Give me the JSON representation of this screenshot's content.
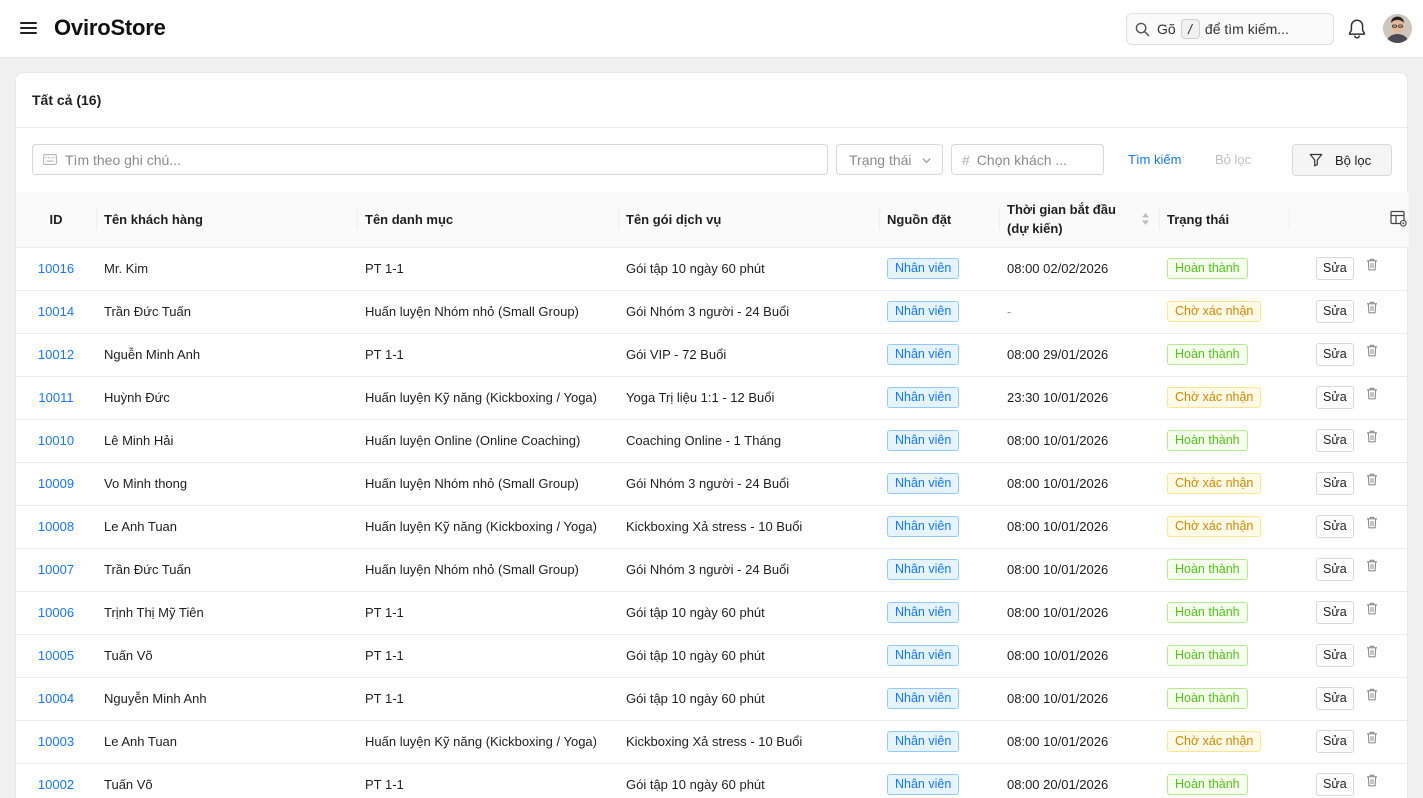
{
  "app": {
    "brand": "OviroStore"
  },
  "header": {
    "search_prefix": "Gõ",
    "search_key": "/",
    "search_suffix": "để tìm kiếm..."
  },
  "card": {
    "title": "Tất cả (16)"
  },
  "filters": {
    "note_placeholder": "Tìm theo ghi chú...",
    "status_placeholder": "Trạng thái",
    "customer_placeholder": "Chọn khách ...",
    "search_label": "Tìm kiếm",
    "clear_label": "Bỏ lọc",
    "filter_label": "Bộ lọc"
  },
  "table": {
    "columns": {
      "id": "ID",
      "customer": "Tên khách hàng",
      "category": "Tên danh mục",
      "package": "Tên gói dịch vụ",
      "source": "Nguồn đặt",
      "start_time": "Thời gian bắt đầu (dự kiến)",
      "status": "Trạng thái"
    },
    "edit_label": "Sửa",
    "status_colors": {
      "Hoàn thành": "#52c41a",
      "Chờ xác nhận": "#d48806"
    },
    "source_color": "#1677ff",
    "rows": [
      {
        "id": "10016",
        "customer": "Mr. Kim",
        "category": "PT 1-1",
        "package": "Gói tập 10 ngày 60 phút",
        "source": "Nhân viên",
        "start_time": "08:00 02/02/2026",
        "status": "Hoàn thành"
      },
      {
        "id": "10014",
        "customer": "Trần Đức Tuấn",
        "category": "Huấn luyện Nhóm nhỏ (Small Group)",
        "package": "Gói Nhóm 3 người - 24 Buổi",
        "source": "Nhân viên",
        "start_time": "-",
        "status": "Chờ xác nhận"
      },
      {
        "id": "10012",
        "customer": "Nguễn Minh Anh",
        "category": "PT 1-1",
        "package": "Gói VIP - 72 Buổi",
        "source": "Nhân viên",
        "start_time": "08:00 29/01/2026",
        "status": "Hoàn thành"
      },
      {
        "id": "10011",
        "customer": "Huỳnh Đức",
        "category": "Huấn luyện Kỹ năng (Kickboxing / Yoga)",
        "package": "Yoga Trị liệu 1:1 - 12 Buổi",
        "source": "Nhân viên",
        "start_time": "23:30 10/01/2026",
        "status": "Chờ xác nhận"
      },
      {
        "id": "10010",
        "customer": "Lê Minh Hải",
        "category": "Huấn luyện Online (Online Coaching)",
        "package": "Coaching Online - 1 Tháng",
        "source": "Nhân viên",
        "start_time": "08:00 10/01/2026",
        "status": "Hoàn thành"
      },
      {
        "id": "10009",
        "customer": "Vo Minh thong",
        "category": "Huấn luyện Nhóm nhỏ (Small Group)",
        "package": "Gói Nhóm 3 người - 24 Buổi",
        "source": "Nhân viên",
        "start_time": "08:00 10/01/2026",
        "status": "Chờ xác nhận"
      },
      {
        "id": "10008",
        "customer": "Le Anh Tuan",
        "category": "Huấn luyện Kỹ năng (Kickboxing / Yoga)",
        "package": "Kickboxing Xả stress - 10 Buổi",
        "source": "Nhân viên",
        "start_time": "08:00 10/01/2026",
        "status": "Chờ xác nhận"
      },
      {
        "id": "10007",
        "customer": "Trần Đức Tuấn",
        "category": "Huấn luyện Nhóm nhỏ (Small Group)",
        "package": "Gói Nhóm 3 người - 24 Buổi",
        "source": "Nhân viên",
        "start_time": "08:00 10/01/2026",
        "status": "Hoàn thành"
      },
      {
        "id": "10006",
        "customer": "Trịnh Thị Mỹ Tiên",
        "category": "PT 1-1",
        "package": "Gói tập 10 ngày 60 phút",
        "source": "Nhân viên",
        "start_time": "08:00 10/01/2026",
        "status": "Hoàn thành"
      },
      {
        "id": "10005",
        "customer": "Tuấn Võ",
        "category": "PT 1-1",
        "package": "Gói tập 10 ngày 60 phút",
        "source": "Nhân viên",
        "start_time": "08:00 10/01/2026",
        "status": "Hoàn thành"
      },
      {
        "id": "10004",
        "customer": "Nguyễn Minh Anh",
        "category": "PT 1-1",
        "package": "Gói tập 10 ngày 60 phút",
        "source": "Nhân viên",
        "start_time": "08:00 10/01/2026",
        "status": "Hoàn thành"
      },
      {
        "id": "10003",
        "customer": "Le Anh Tuan",
        "category": "Huấn luyện Kỹ năng (Kickboxing / Yoga)",
        "package": "Kickboxing Xả stress - 10 Buổi",
        "source": "Nhân viên",
        "start_time": "08:00 10/01/2026",
        "status": "Chờ xác nhận"
      },
      {
        "id": "10002",
        "customer": "Tuấn Võ",
        "category": "PT 1-1",
        "package": "Gói tập 10 ngày 60 phút",
        "source": "Nhân viên",
        "start_time": "08:00 20/01/2026",
        "status": "Hoàn thành"
      }
    ]
  }
}
